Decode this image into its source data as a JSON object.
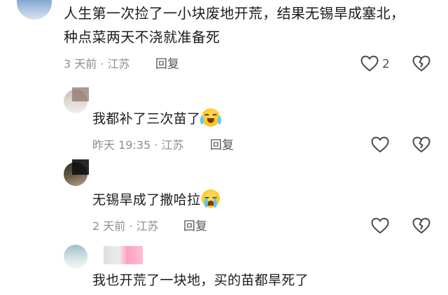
{
  "comments": [
    {
      "text_line1": "人生第一次捡了一小块废地开荒，结果无锡旱成塞北，",
      "text_line2": "种点菜两天不浇就准备死",
      "meta": "3 天前 · 江苏",
      "reply_label": "回复",
      "like_count": "2"
    }
  ],
  "replies": [
    {
      "text": "我都补了三次苗了",
      "meta": "昨天 19:35 · 江苏",
      "reply_label": "回复",
      "emoji": "crying-laughing-emoji"
    },
    {
      "text": "无锡旱成了撒哈拉",
      "meta": "2 天前 · 江苏",
      "reply_label": "回复",
      "emoji": "loudly-crying-emoji"
    },
    {
      "text": "我也开荒了一块地，买的苗都旱死了"
    }
  ],
  "icons": {
    "like": "heart-outline-icon",
    "dislike": "broken-heart-icon"
  },
  "colors": {
    "meta_gray": "#8e8e93",
    "text": "#1c1c1c",
    "icon_gray": "#4a4a4a"
  }
}
